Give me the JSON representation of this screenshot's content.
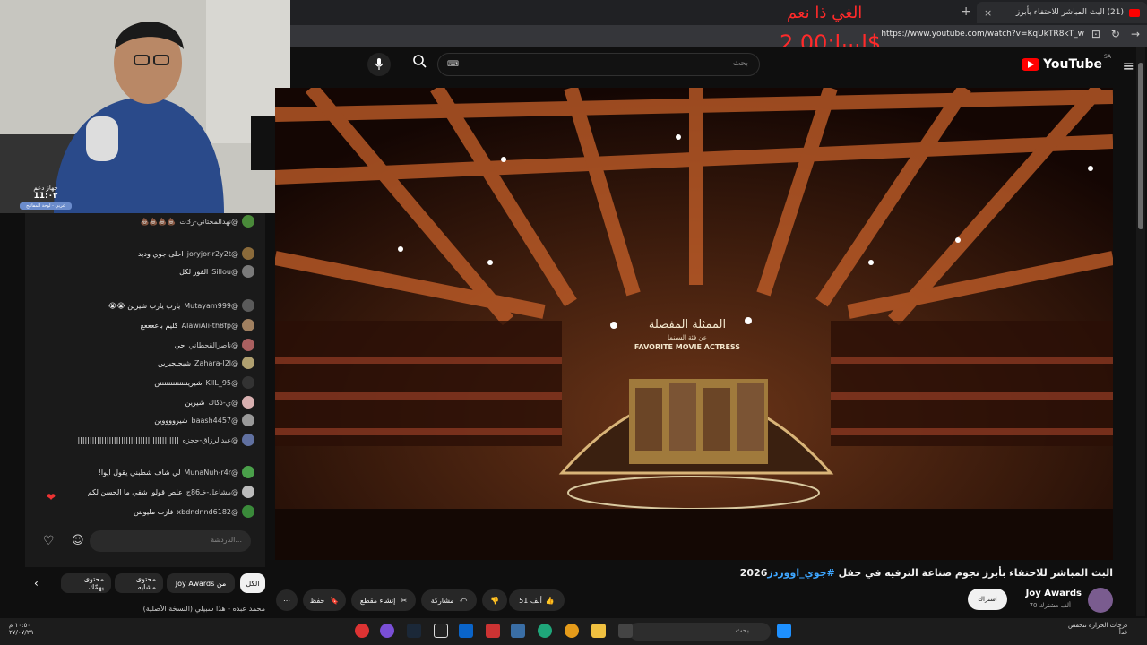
{
  "browser": {
    "tab_title": "(21) البث المباشر للاحتفاء بأبرز",
    "tab_close": "×",
    "new_tab": "+",
    "url": "https://www.youtube.com/watch?v=KqUkTR8kT_w"
  },
  "overlay": {
    "line1": "الغي ذا نعم",
    "line2": "ليبيا:2.00$"
  },
  "youtube": {
    "logo_text": "YouTube",
    "region": "SA",
    "search_placeholder": "بحث"
  },
  "video": {
    "stage_title_ar": "الممثلة المفضلة",
    "stage_subtitle_ar": "عن فئة السينما",
    "stage_title_en": "FAVORITE MOVIE ACTRESS",
    "title_main": "البث المباشر للاحتفاء بأبرز نجوم صناعة الترفيه في حفل ",
    "title_tag": "#جوي_اووردز",
    "title_year": "2026",
    "channel_name": "Joy Awards",
    "subscribers": "70 ألف مشترك",
    "subscribe_label": "اشتراك",
    "likes": "51 ألف",
    "share_label": "مشاركة",
    "clip_label": "إنشاء مقطع",
    "save_label": "حفظ",
    "more_label": "⋯"
  },
  "chat": {
    "messages": [
      {
        "user": "@نهدالمحتاني-ر3ت",
        "text": "💩💩💩💩"
      },
      {
        "user": "@joryjor-r2y2t",
        "text": "احلى جوي وديد"
      },
      {
        "user": "@Sillou",
        "text": "الفوز لكل"
      },
      {
        "user": "@Mutayam999",
        "text": "يارب يارب شيرين 😭😭"
      },
      {
        "user": "@AlawiAli-th8fp",
        "text": "كليم باععععع"
      },
      {
        "user": "@ناصرالقحطاني",
        "text": "حي"
      },
      {
        "user": "@Zahara-l2l",
        "text": "شيجيجيرين"
      },
      {
        "user": "@KlIL_95",
        "text": "شيرينننننننننننننن"
      },
      {
        "user": "@ي-ذكاك",
        "text": "شيرين"
      },
      {
        "user": "@baash4457",
        "text": "شيرووووين"
      },
      {
        "user": "@عبدالرزاق-حجزه",
        "text": "||||||||||||||||||||||||||||||||||||||||||"
      },
      {
        "user": "@MunaNuh-r4r",
        "text": "لي شاف شطبني يقول ايوا!"
      },
      {
        "user": "@مشاعل-خـ86ج",
        "text": "علص قولوا شفي ما الحسن لكم"
      },
      {
        "user": "@xbdndnnd6182",
        "text": "فازت مليوننن"
      }
    ],
    "input_placeholder": "الدردشة..."
  },
  "chips": {
    "all": "الكل",
    "from_channel": "من Joy Awards",
    "similar": "محتوى مشابه",
    "for_you": "محتوى يهمّك"
  },
  "recommendation": "محمد عبده - هذا سبيلي (النسخة الأصلية)",
  "webcam_widget": {
    "line1": "جهاز دعم",
    "line2": "11:٠٢",
    "line3": "عربي - لوحة المفاتيح"
  },
  "taskbar": {
    "search_placeholder": "بحث",
    "weather": "درجات الحرارة تنخفض",
    "weather_sub": "غداً",
    "time": "١٠:٥٠ م",
    "date": "٢٧/٠٧/٢٩"
  },
  "colors": {
    "accent_red": "#ff0000",
    "overlay_red": "#ff2a2a",
    "link_blue": "#3ea6ff",
    "background": "#0f0f0f"
  }
}
